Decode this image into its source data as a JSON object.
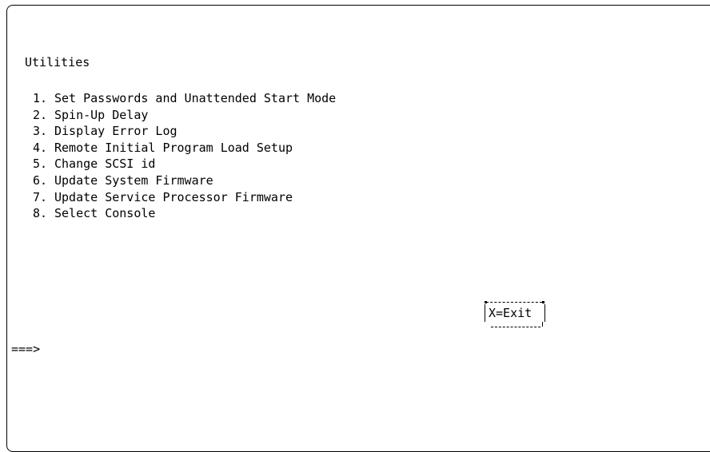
{
  "screen": {
    "title": "Utilities",
    "menu": [
      {
        "num": "1.",
        "label": "Set Passwords and Unattended Start Mode"
      },
      {
        "num": "2.",
        "label": "Spin-Up Delay"
      },
      {
        "num": "3.",
        "label": "Display Error Log"
      },
      {
        "num": "4.",
        "label": "Remote Initial Program Load Setup"
      },
      {
        "num": "5.",
        "label": "Change SCSI id"
      },
      {
        "num": "6.",
        "label": "Update System Firmware"
      },
      {
        "num": "7.",
        "label": "Update Service Processor Firmware"
      },
      {
        "num": "8.",
        "label": "Select Console"
      }
    ],
    "exit_label": "X=Exit",
    "prompt": "===>",
    "input_value": ""
  }
}
